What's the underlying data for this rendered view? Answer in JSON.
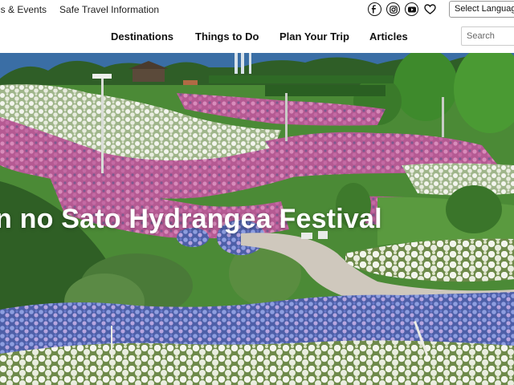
{
  "topbar": {
    "links": [
      "gs & Events",
      "Safe Travel Information"
    ],
    "social_icons": [
      "facebook-icon",
      "instagram-icon",
      "youtube-icon",
      "heart-icon"
    ],
    "language_label": "Select Language"
  },
  "nav": {
    "items": [
      "Destinations",
      "Things to Do",
      "Plan Your Trip",
      "Articles"
    ],
    "search_placeholder": "Search"
  },
  "hero": {
    "title": "n no Sato Hydrangea Festival"
  },
  "colors": {
    "text": "#111111",
    "sky": "#3a6ea5",
    "foliage": "#3d7a2e",
    "hydrangea_pink": "#c96fa6",
    "hydrangea_blue": "#7e8fd6",
    "hydrangea_white": "#f2f4ec"
  }
}
